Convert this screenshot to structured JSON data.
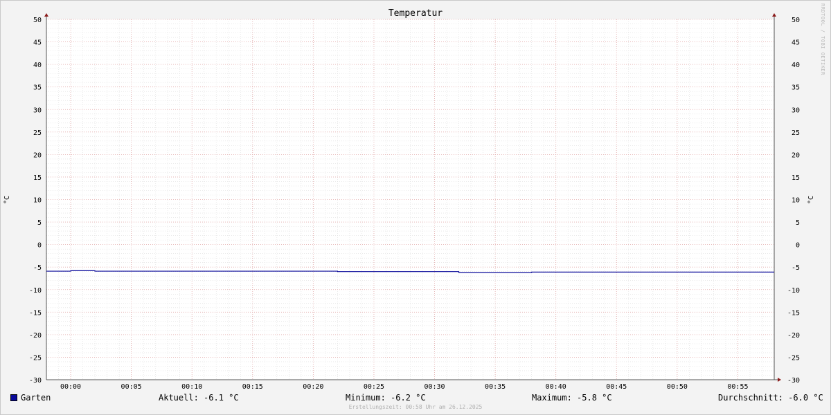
{
  "chart_data": {
    "type": "line",
    "title": "Temperatur",
    "ylabel": "°C",
    "ylim": [
      -30,
      50
    ],
    "y_ticks": [
      "50",
      "45",
      "40",
      "35",
      "30",
      "25",
      "20",
      "15",
      "10",
      "5",
      "0",
      "-5",
      "-10",
      "-15",
      "-20",
      "-25",
      "-30"
    ],
    "x_ticks": [
      "00:00",
      "00:05",
      "00:10",
      "00:15",
      "00:20",
      "00:25",
      "00:30",
      "00:35",
      "00:40",
      "00:45",
      "00:50",
      "00:55"
    ],
    "x_range_minutes": [
      -2,
      58
    ],
    "grid": true,
    "series": [
      {
        "name": "Garten",
        "color": "#0a0a9a",
        "x": [
          -2,
          0,
          2,
          22,
          32,
          38,
          58
        ],
        "y": [
          -5.9,
          -5.8,
          -5.9,
          -6.0,
          -6.2,
          -6.1,
          -6.1
        ]
      }
    ]
  },
  "legend": {
    "series_name": "Garten",
    "current": "Aktuell: -6.1 °C",
    "minimum": "Minimum: -6.2 °C",
    "maximum": "Maximum: -5.8 °C",
    "average": "Durchschnitt: -6.0 °C"
  },
  "footer": {
    "creation_time": "Erstellungszeit: 00:58 Uhr am 26.12.2025"
  },
  "watermark": "RRDTOOL / TOBI OETIKER"
}
